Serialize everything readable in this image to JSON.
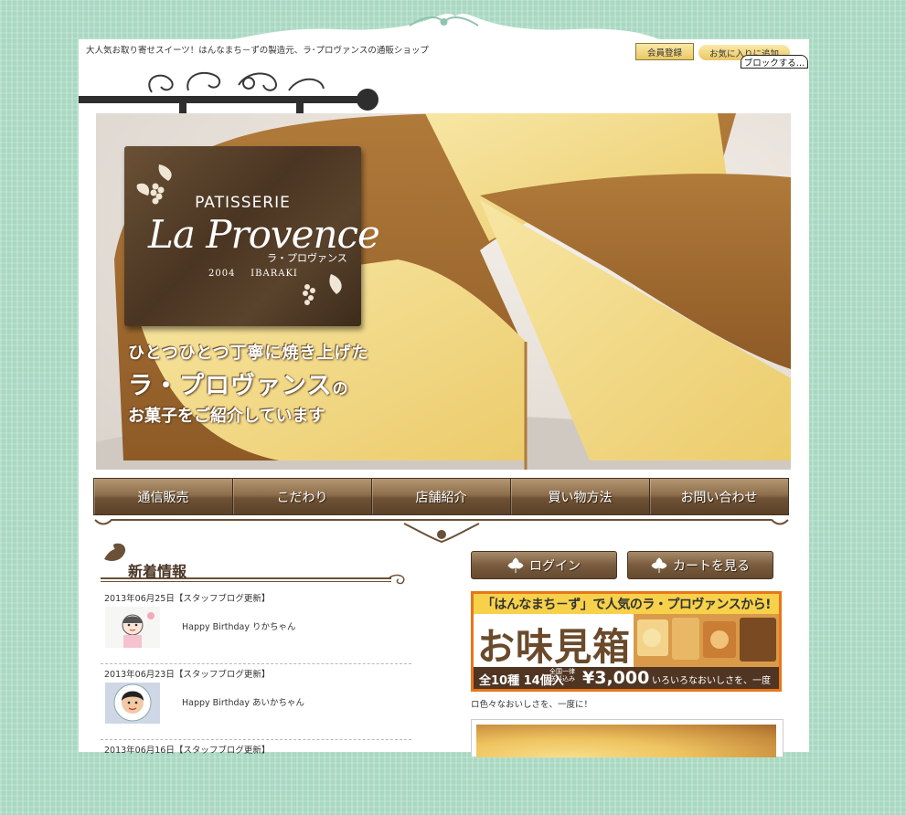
{
  "header": {
    "tagline": "大人気お取り寄せスイーツ！はんなまち－ずの製造元、ラ･プロヴァンスの通販ショップ",
    "member_btn": "会員登録",
    "fav_btn": "お気に入りに追加",
    "block_btn": "ブロックする…"
  },
  "sign": {
    "patisserie": "PATISSERIE",
    "name": "La Provence",
    "kana": "ラ・プロヴァンス",
    "year": "2004",
    "place": "IBARAKI"
  },
  "hero": {
    "line1": "ひとつひとつ丁寧に焼き上げた",
    "line2": "ラ・プロヴァンス",
    "line2_suffix": "の",
    "line3": "お菓子をご紹介しています"
  },
  "nav": {
    "items": [
      "通信販売",
      "こだわり",
      "店舗紹介",
      "買い物方法",
      "お問い合わせ"
    ]
  },
  "news": {
    "title": "新着情報",
    "items": [
      {
        "date": "2013年06月25日【スタッフブログ更新】",
        "text": "Happy Birthday りかちゃん"
      },
      {
        "date": "2013年06月23日【スタッフブログ更新】",
        "text": "Happy Birthday あいかちゃん"
      },
      {
        "date": "2013年06月16日【スタッフブログ更新】",
        "text": ""
      }
    ]
  },
  "side": {
    "login": "ログイン",
    "cart": "カートを見る",
    "banner_top": "「はんなまち－ず」で人気のラ・プロヴァンスから!",
    "banner_title": "お味見箱",
    "banner_count": "全10種 14個入",
    "banner_ship1": "全国一律",
    "banner_ship2": "送料込み",
    "banner_price": "¥3,000",
    "banner_note": "いろいろなおいしさを、一度に!",
    "banner_caption": "ロ色々なおいしさを、一度に！"
  },
  "colors": {
    "background": "#a9d8c2",
    "brown": "#6e5235",
    "banner_orange": "#e8761a",
    "banner_yellow": "#f7d14a"
  }
}
